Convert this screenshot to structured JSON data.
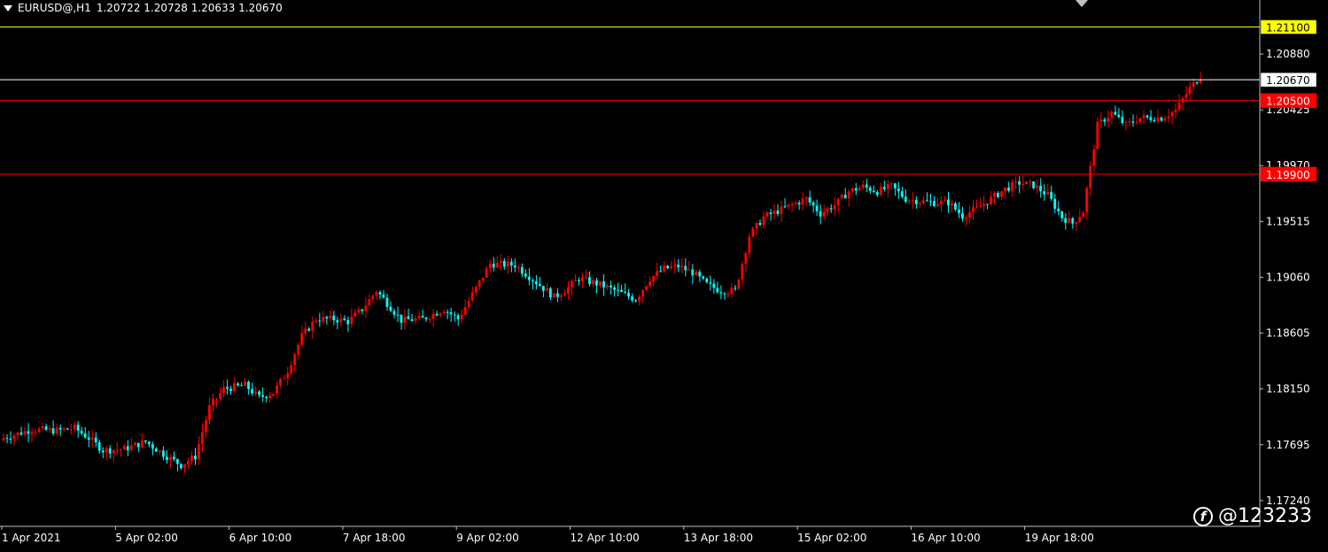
{
  "header": {
    "symbol_tf": "EURUSD@,H1",
    "ohlc": "1.20722 1.20728 1.20633 1.20670"
  },
  "watermark": {
    "logo_glyph": "f",
    "text": "@123233"
  },
  "colors": {
    "background": "#000000",
    "bull": "#ff0000",
    "bear": "#00ffff",
    "grid_axis": "#c0c0c0",
    "line_yellow": "#ffff00",
    "line_current": "#ffffff",
    "line_red": "#ff0000",
    "label_yellow_bg": "#ffff00",
    "label_red_bg": "#ff0000"
  },
  "chart_data": {
    "type": "candlestick",
    "symbol": "EURUSD@",
    "timeframe": "H1",
    "ylim": [
      1.1703,
      1.2132
    ],
    "y_ticks": [
      "1.20880",
      "1.20425",
      "1.19970",
      "1.19515",
      "1.19060",
      "1.18605",
      "1.18150",
      "1.17695",
      "1.17240"
    ],
    "x_ticks": [
      "1 Apr 2021",
      "5 Apr 02:00",
      "6 Apr 10:00",
      "7 Apr 18:00",
      "9 Apr 02:00",
      "12 Apr 10:00",
      "13 Apr 18:00",
      "15 Apr 02:00",
      "16 Apr 10:00",
      "19 Apr 18:00"
    ],
    "bars_per_tick": 32,
    "price_lines": [
      {
        "price": 1.211,
        "label": "1.21100",
        "style": "yellow"
      },
      {
        "price": 1.2067,
        "label": "1.20670",
        "style": "current"
      },
      {
        "price": 1.205,
        "label": "1.20500",
        "style": "red"
      },
      {
        "price": 1.199,
        "label": "1.19900",
        "style": "red"
      }
    ],
    "close_path": [
      [
        0,
        1.1775
      ],
      [
        8,
        1.1782
      ],
      [
        15,
        1.1781
      ],
      [
        20,
        1.1783
      ],
      [
        24,
        1.1775
      ],
      [
        28,
        1.1765
      ],
      [
        34,
        1.1766
      ],
      [
        40,
        1.1772
      ],
      [
        46,
        1.176
      ],
      [
        50,
        1.1753
      ],
      [
        54,
        1.176
      ],
      [
        58,
        1.18
      ],
      [
        62,
        1.1815
      ],
      [
        68,
        1.1818
      ],
      [
        72,
        1.1808
      ],
      [
        76,
        1.1812
      ],
      [
        80,
        1.183
      ],
      [
        84,
        1.1858
      ],
      [
        88,
        1.1872
      ],
      [
        93,
        1.1872
      ],
      [
        97,
        1.187
      ],
      [
        101,
        1.188
      ],
      [
        105,
        1.1895
      ],
      [
        108,
        1.1885
      ],
      [
        112,
        1.1871
      ],
      [
        118,
        1.1872
      ],
      [
        124,
        1.188
      ],
      [
        128,
        1.1872
      ],
      [
        132,
        1.1892
      ],
      [
        137,
        1.1917
      ],
      [
        144,
        1.1916
      ],
      [
        150,
        1.1902
      ],
      [
        155,
        1.189
      ],
      [
        158,
        1.1895
      ],
      [
        162,
        1.1905
      ],
      [
        168,
        1.19
      ],
      [
        174,
        1.1893
      ],
      [
        178,
        1.1888
      ],
      [
        182,
        1.1905
      ],
      [
        186,
        1.1913
      ],
      [
        190,
        1.1915
      ],
      [
        194,
        1.191
      ],
      [
        198,
        1.19
      ],
      [
        202,
        1.1895
      ],
      [
        206,
        1.1895
      ],
      [
        210,
        1.194
      ],
      [
        214,
        1.1955
      ],
      [
        218,
        1.196
      ],
      [
        222,
        1.1965
      ],
      [
        226,
        1.197
      ],
      [
        230,
        1.1958
      ],
      [
        234,
        1.1965
      ],
      [
        238,
        1.1976
      ],
      [
        242,
        1.198
      ],
      [
        246,
        1.1976
      ],
      [
        250,
        1.198
      ],
      [
        254,
        1.197
      ],
      [
        258,
        1.1968
      ],
      [
        262,
        1.1967
      ],
      [
        266,
        1.1967
      ],
      [
        270,
        1.1956
      ],
      [
        274,
        1.1962
      ],
      [
        278,
        1.197
      ],
      [
        282,
        1.1978
      ],
      [
        286,
        1.1983
      ],
      [
        290,
        1.1981
      ],
      [
        294,
        1.1973
      ],
      [
        298,
        1.1955
      ],
      [
        301,
        1.195
      ],
      [
        304,
        1.196
      ],
      [
        308,
        1.203
      ],
      [
        312,
        1.204
      ],
      [
        316,
        1.203
      ],
      [
        320,
        1.2036
      ],
      [
        326,
        1.2036
      ],
      [
        330,
        1.2042
      ],
      [
        334,
        1.206
      ],
      [
        337,
        1.207
      ]
    ]
  }
}
